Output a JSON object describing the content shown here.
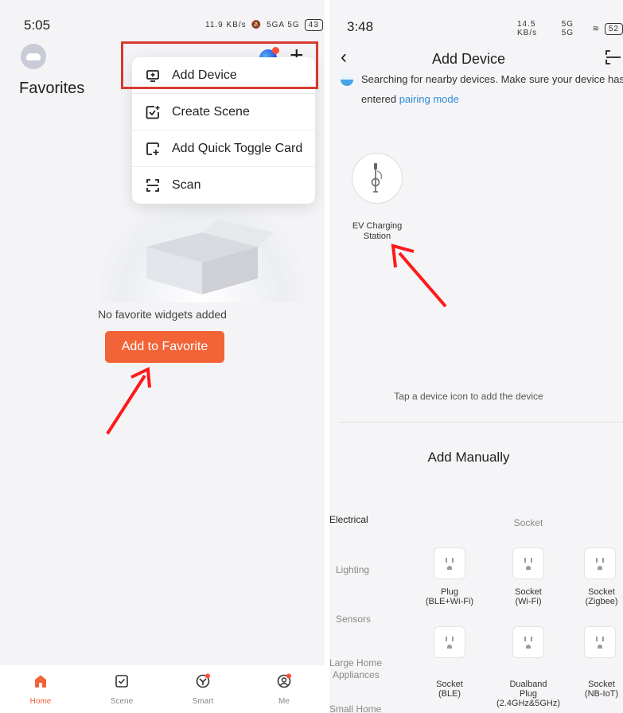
{
  "left": {
    "status": {
      "time": "5:05",
      "speed": "11.9 KB/s",
      "network": "5GA 5G",
      "battery": "43"
    },
    "page_title": "Favorites",
    "menu": [
      {
        "label": "Add Device",
        "icon": "add-device-icon"
      },
      {
        "label": "Create Scene",
        "icon": "create-scene-icon"
      },
      {
        "label": "Add Quick Toggle Card",
        "icon": "quick-toggle-icon"
      },
      {
        "label": "Scan",
        "icon": "scan-icon"
      }
    ],
    "empty_text": "No favorite widgets added",
    "add_favorite_label": "Add to Favorite",
    "tabs": [
      {
        "label": "Home",
        "icon": "home-icon"
      },
      {
        "label": "Scene",
        "icon": "scene-icon"
      },
      {
        "label": "Smart",
        "icon": "smart-icon"
      },
      {
        "label": "Me",
        "icon": "profile-icon"
      }
    ],
    "accent": "#f26438",
    "highlight_color": "#d63b2f"
  },
  "right": {
    "status": {
      "time": "3:48",
      "speed": "14.5 KB/s",
      "network": "5G 5G",
      "battery": "52"
    },
    "title": "Add Device",
    "searching_text": "Searching for nearby devices. Make sure your device has",
    "searching_text_2": "entered ",
    "pairing_link": "pairing mode",
    "device": {
      "line1": "EV Charging",
      "line2": "Station"
    },
    "tap_text": "Tap a device icon to add the device",
    "add_manually": "Add Manually",
    "categories": [
      "Electrical",
      "Lighting",
      "Sensors",
      "Large Home",
      "Appliances",
      "Small Home"
    ],
    "section_label": "Socket",
    "products": [
      {
        "line1": "Plug",
        "line2": "(BLE+Wi-Fi)",
        "line3": ""
      },
      {
        "line1": "Socket",
        "line2": "(Wi-Fi)",
        "line3": ""
      },
      {
        "line1": "Socket",
        "line2": "(Zigbee)",
        "line3": ""
      },
      {
        "line1": "Socket",
        "line2": "(BLE)",
        "line3": ""
      },
      {
        "line1": "Dualband",
        "line2": "Plug",
        "line3": "(2.4GHz&5GHz)"
      },
      {
        "line1": "Socket",
        "line2": "(NB-IoT)",
        "line3": ""
      }
    ],
    "link_color": "#2f8bd8",
    "arrow_color": "#ff1a1a"
  }
}
